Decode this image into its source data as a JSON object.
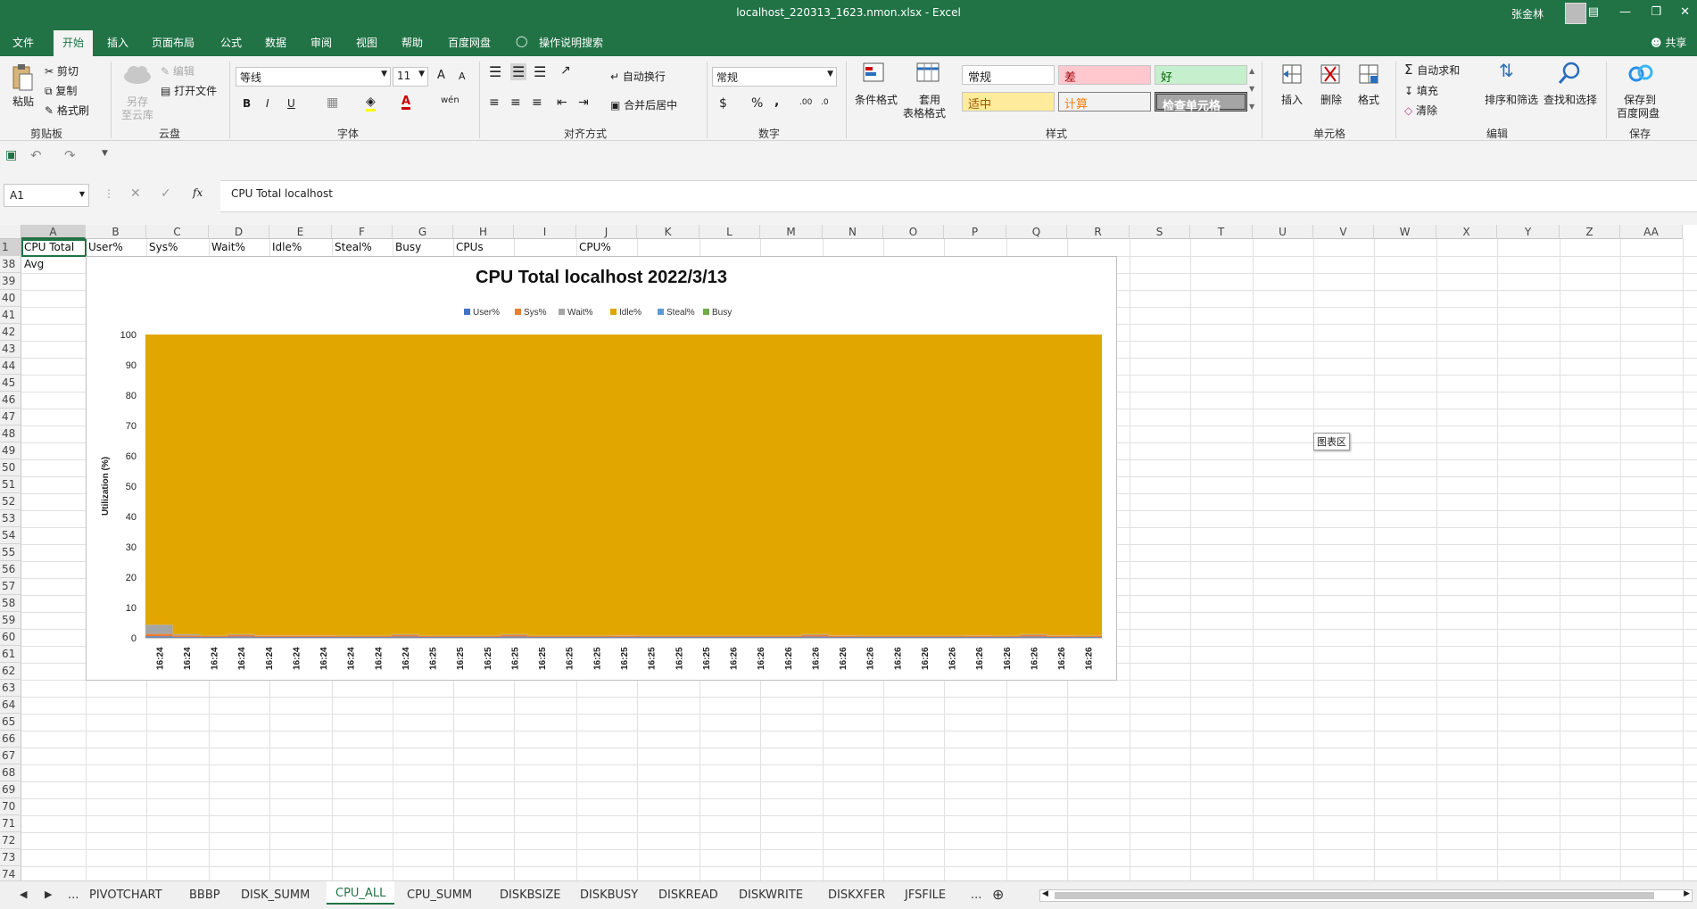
{
  "window": {
    "title": "localhost_220313_1623.nmon.xlsx  -  Excel",
    "user": "张金林"
  },
  "ribbon_tabs": [
    "文件",
    "开始",
    "插入",
    "页面布局",
    "公式",
    "数据",
    "审阅",
    "视图",
    "帮助",
    "百度网盘",
    "操作说明搜索"
  ],
  "account": {
    "share": "共享"
  },
  "clipboard": {
    "paste": "粘贴",
    "cut": "剪切",
    "copy": "复制",
    "format_painter": "格式刷",
    "group": "剪贴板"
  },
  "cloud": {
    "save_as_cloud_1": "另存",
    "save_as_cloud_2": "至云库",
    "edit": "编辑",
    "open_file": "打开文件",
    "group": "云盘"
  },
  "font": {
    "name": "等线",
    "size": "11",
    "bold": "B",
    "italic": "I",
    "underline": "U",
    "grow": "A",
    "shrink": "A",
    "color_a": "A",
    "wen": "wén",
    "group": "字体"
  },
  "alignment": {
    "wrap": "自动换行",
    "merge": "合并后居中",
    "group": "对齐方式"
  },
  "number": {
    "format": "常规",
    "currency": "$",
    "percent": "%",
    "comma": ",",
    "inc_dec": ".00",
    "dec_dec": ".0",
    "group": "数字"
  },
  "styles": {
    "cond_format_1": "条件格式",
    "table_format_1": "套用",
    "table_format_2": "表格格式",
    "normal": "常规",
    "bad": "差",
    "good": "好",
    "neutral": "适中",
    "calc": "计算",
    "check": "检查单元格",
    "group": "样式"
  },
  "cells": {
    "insert": "插入",
    "delete": "删除",
    "format": "格式",
    "group": "单元格"
  },
  "editing": {
    "autosum": "自动求和",
    "fill": "填充",
    "clear": "清除",
    "sort": "排序和筛选",
    "find": "查找和选择",
    "group": "编辑"
  },
  "save": {
    "save_to_1": "保存到",
    "save_to_2": "百度网盘",
    "group": "保存"
  },
  "formula_bar": {
    "name_box": "A1",
    "fx": "fx",
    "content": "CPU Total localhost"
  },
  "sheet": {
    "columns": [
      "A",
      "B",
      "C",
      "D",
      "E",
      "F",
      "G",
      "H",
      "I",
      "J",
      "K",
      "L",
      "M",
      "N",
      "O",
      "P",
      "Q",
      "R",
      "S",
      "T",
      "U",
      "V",
      "W",
      "X",
      "Y",
      "Z",
      "AA"
    ],
    "rows": [
      "1",
      "38",
      "39",
      "40",
      "41",
      "42",
      "43",
      "44",
      "45",
      "46",
      "47",
      "48",
      "49",
      "50",
      "51",
      "52",
      "53",
      "54",
      "55",
      "56",
      "57",
      "58",
      "59",
      "60",
      "61",
      "62",
      "63",
      "64",
      "65",
      "66",
      "67",
      "68",
      "69",
      "70",
      "71",
      "72",
      "73",
      "74"
    ],
    "row1": [
      "CPU Total",
      "User%",
      "Sys%",
      "Wait%",
      "Idle%",
      "Steal%",
      "Busy",
      "CPUs",
      "",
      "CPU%"
    ],
    "row38_a": "Avg"
  },
  "tooltip": "图表区",
  "sheet_tabs": [
    "PIVOTCHART",
    "BBBP",
    "DISK_SUMM",
    "CPU_ALL",
    "CPU_SUMM",
    "DISKBSIZE",
    "DISKBUSY",
    "DISKREAD",
    "DISKWRITE",
    "DISKXFER",
    "JFSFILE"
  ],
  "sheet_nav": {
    "more_left": "...",
    "more_right": "...",
    "add": "⊕"
  },
  "colors": {
    "excel_green": "#217346",
    "idle": "#E1A700",
    "user": "#4472C4",
    "sys": "#ED7D31",
    "wait": "#A5A5A5"
  },
  "chart_data": {
    "type": "area",
    "stacked": true,
    "title": "CPU Total localhost  2022/3/13",
    "xlabel": "",
    "ylabel": "Utilization (%)",
    "ylim": [
      0,
      100
    ],
    "yticks": [
      0,
      10,
      20,
      30,
      40,
      50,
      60,
      70,
      80,
      90,
      100
    ],
    "legend_position": "top",
    "x": [
      "16:24",
      "16:24",
      "16:24",
      "16:24",
      "16:24",
      "16:24",
      "16:24",
      "16:24",
      "16:24",
      "16:24",
      "16:25",
      "16:25",
      "16:25",
      "16:25",
      "16:25",
      "16:25",
      "16:25",
      "16:25",
      "16:25",
      "16:25",
      "16:25",
      "16:26",
      "16:26",
      "16:26",
      "16:26",
      "16:26",
      "16:26",
      "16:26",
      "16:26",
      "16:26",
      "16:26",
      "16:26",
      "16:26",
      "16:26",
      "16:26"
    ],
    "series": [
      {
        "name": "User%",
        "color": "#4472C4",
        "values": [
          0.5,
          0.3,
          0.3,
          0.4,
          0.3,
          0.3,
          0.3,
          0.3,
          0.3,
          0.4,
          0.3,
          0.3,
          0.3,
          0.4,
          0.3,
          0.3,
          0.3,
          0.3,
          0.3,
          0.3,
          0.3,
          0.3,
          0.3,
          0.3,
          0.4,
          0.3,
          0.3,
          0.3,
          0.3,
          0.3,
          0.3,
          0.3,
          0.4,
          0.3,
          0.3
        ]
      },
      {
        "name": "Sys%",
        "color": "#ED7D31",
        "values": [
          0.8,
          0.5,
          0.3,
          0.6,
          0.4,
          0.4,
          0.4,
          0.3,
          0.3,
          0.6,
          0.3,
          0.3,
          0.3,
          0.6,
          0.3,
          0.3,
          0.3,
          0.4,
          0.3,
          0.3,
          0.3,
          0.3,
          0.3,
          0.3,
          0.6,
          0.4,
          0.3,
          0.3,
          0.3,
          0.3,
          0.4,
          0.3,
          0.6,
          0.4,
          0.3
        ]
      },
      {
        "name": "Wait%",
        "color": "#A5A5A5",
        "values": [
          3.0,
          0.4,
          0.1,
          0.2,
          0.1,
          0.1,
          0.1,
          0.1,
          0.1,
          0.2,
          0.1,
          0.1,
          0.1,
          0.2,
          0.1,
          0.1,
          0.1,
          0.1,
          0.1,
          0.1,
          0.1,
          0.1,
          0.1,
          0.1,
          0.2,
          0.1,
          0.1,
          0.1,
          0.1,
          0.1,
          0.1,
          0.1,
          0.2,
          0.1,
          0.1
        ]
      },
      {
        "name": "Idle%",
        "color": "#E1A700",
        "values": [
          95.7,
          98.8,
          99.3,
          98.8,
          99.2,
          99.2,
          99.2,
          99.3,
          99.3,
          98.8,
          99.3,
          99.3,
          99.3,
          98.8,
          99.3,
          99.3,
          99.3,
          99.2,
          99.3,
          99.3,
          99.3,
          99.3,
          99.3,
          99.3,
          98.8,
          99.2,
          99.3,
          99.3,
          99.3,
          99.3,
          99.2,
          99.3,
          98.8,
          99.2,
          99.3
        ]
      },
      {
        "name": "Steal%",
        "color": "#5B9BD5",
        "values": [
          0,
          0,
          0,
          0,
          0,
          0,
          0,
          0,
          0,
          0,
          0,
          0,
          0,
          0,
          0,
          0,
          0,
          0,
          0,
          0,
          0,
          0,
          0,
          0,
          0,
          0,
          0,
          0,
          0,
          0,
          0,
          0,
          0,
          0,
          0
        ]
      },
      {
        "name": "Busy",
        "color": "#70AD47",
        "values": [
          0,
          0,
          0,
          0,
          0,
          0,
          0,
          0,
          0,
          0,
          0,
          0,
          0,
          0,
          0,
          0,
          0,
          0,
          0,
          0,
          0,
          0,
          0,
          0,
          0,
          0,
          0,
          0,
          0,
          0,
          0,
          0,
          0,
          0,
          0
        ]
      }
    ]
  }
}
